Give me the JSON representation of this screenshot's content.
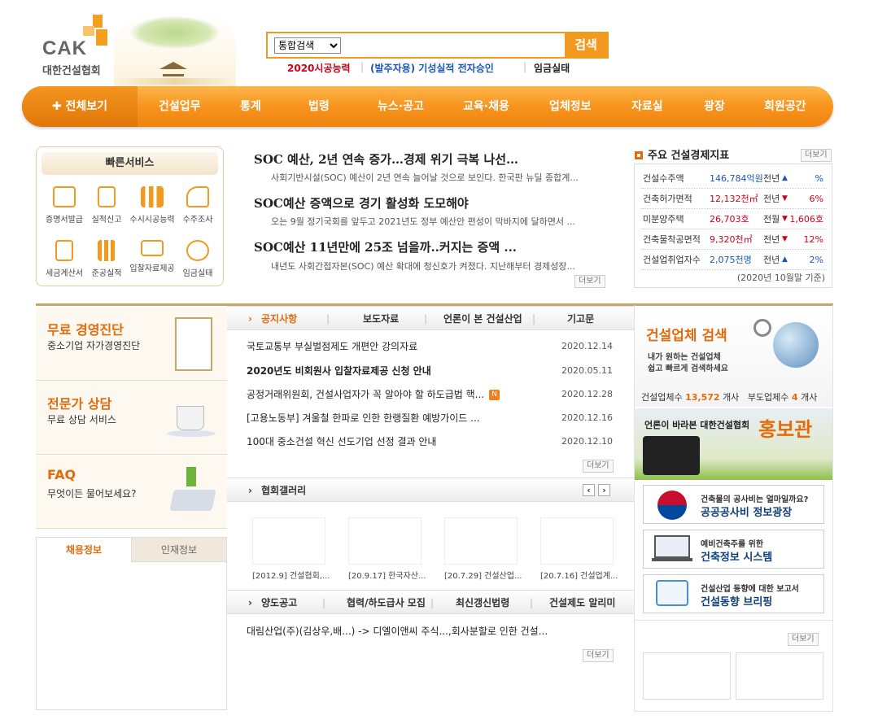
{
  "header": {
    "logo_text": "CAK",
    "logo_name": "대한건설협회",
    "search_select": "통합검색",
    "search_button": "검색",
    "quick_links": [
      "2020시공능력",
      "(발주자용) 기성실적 전자승인",
      "임금실태"
    ]
  },
  "nav": {
    "all": "✚ 전체보기",
    "items": [
      "건설업무",
      "통계",
      "법령",
      "뉴스·공고",
      "교육·채용",
      "업체정보",
      "자료실",
      "광장",
      "회원공간"
    ]
  },
  "quick_service": {
    "title": "빠른서비스",
    "items": [
      "증명서발급",
      "실적신고",
      "수시시공능력",
      "수주조사",
      "세금계산서",
      "준공실적",
      "입찰자료제공",
      "임금실태"
    ]
  },
  "news": {
    "items": [
      {
        "title": "SOC 예산, 2년 연속 증가…경제 위기 극복 나선…",
        "summary": "사회기반시설(SOC) 예산이 2년 연속 늘어날 것으로 보인다. 한국판 뉴딜 종합계..."
      },
      {
        "title": "SOC예산 증액으로 경기 활성화 도모해야",
        "summary": "오는 9월 정기국회를 앞두고 2021년도 정부 예산안 편성이 막바지에 달하면서 ..."
      },
      {
        "title": "SOC예산 11년만에 25조 넘을까..커지는 증액 ...",
        "summary": "내년도 사회간접자본(SOC) 예산 확대에 청신호가 켜졌다. 지난해부터 경제성장..."
      }
    ],
    "more": "더보기"
  },
  "indicators": {
    "title": "주요 건설경제지표",
    "more": "더보기",
    "rows": [
      {
        "label": "건설수주액",
        "value": "146,784억원",
        "compare": "전년",
        "dir": "up",
        "change": "%"
      },
      {
        "label": "건축허가면적",
        "value": "12,132천㎡",
        "compare": "전년",
        "dir": "down",
        "change": "6%"
      },
      {
        "label": "미분양주택",
        "value": "26,703호",
        "compare": "전월",
        "dir": "down",
        "change": "1,606호"
      },
      {
        "label": "건축물착공면적",
        "value": "9,320천㎡",
        "compare": "전년",
        "dir": "down",
        "change": "12%"
      },
      {
        "label": "건설업취업자수",
        "value": "2,075천명",
        "compare": "전년",
        "dir": "up",
        "change": "2%"
      }
    ],
    "note": "(2020년 10월말 기준)",
    "colors": {
      "up": "#1a56b8",
      "down": "#d0021b"
    }
  },
  "cards": [
    {
      "heading": "무료 경영진단",
      "sub": "중소기업 자가경영진단"
    },
    {
      "heading": "전문가 상담",
      "sub": "무료 상담 서비스"
    },
    {
      "heading": "FAQ",
      "sub": "무엇이든 물어보세요?"
    }
  ],
  "recruit": {
    "tab_active": "채용정보",
    "tab_other": "인재정보"
  },
  "board": {
    "tabs": [
      "공지사항",
      "보도자료",
      "언론이 본 건설산업",
      "기고문"
    ],
    "posts": [
      {
        "title": "국토교통부 부실벌점제도 개편안 강의자료",
        "date": "2020.12.14"
      },
      {
        "title": "2020년도 비회원사 입찰자료제공 신청 안내",
        "date": "2020.05.11"
      },
      {
        "title": "공정거래위원회, 건설사업자가 꼭 알아야 할 하도급법 핵...",
        "date": "2020.12.28",
        "badge": "N"
      },
      {
        "title": "[고용노동부] 겨울철 한파로 인한 한랭질환 예방가이드 ...",
        "date": "2020.12.16"
      },
      {
        "title": "100대 중소건설 혁신 선도기업 선정 결과 안내",
        "date": "2020.12.10"
      }
    ],
    "more": "더보기"
  },
  "gallery": {
    "title": "협회갤러리",
    "captions": [
      "[2012.9] 건설협회,...",
      "[20.9.17] 한국자산...",
      "[20.7.29] 건설산업...",
      "[20.7.16] 건설업계..."
    ]
  },
  "board2": {
    "tabs": [
      "양도공고",
      "협력/하도급사 모집",
      "최신갱신법령",
      "건설제도 알리미"
    ],
    "post": "대림산업(주)(김상우,배...) -> 디엘이앤씨 주식...,회사분할로 인한 건설...",
    "more": "더보기"
  },
  "company_search": {
    "title": "건설업체 검색",
    "line1": "내가 원하는 건설업체",
    "line2": "쉽고 빠르게 검색하세요",
    "count_label1": "건설업체수",
    "count1": "13,572",
    "unit": "개사",
    "count_label2": "부도업체수",
    "count2": "4"
  },
  "promo": {
    "line": "언론이 바라본 대한건설협회",
    "big": "홍보관"
  },
  "banners": [
    {
      "l1": "건축물의 공사비는 얼마일까요?",
      "l2": "공공공사비 정보광장"
    },
    {
      "l1": "예비건축주를 위한",
      "l2": "건축정보 시스템"
    },
    {
      "l1": "건설산업 동향에 대한 보고서",
      "l2": "건설동향 브리핑"
    }
  ],
  "right_more": "더보기"
}
